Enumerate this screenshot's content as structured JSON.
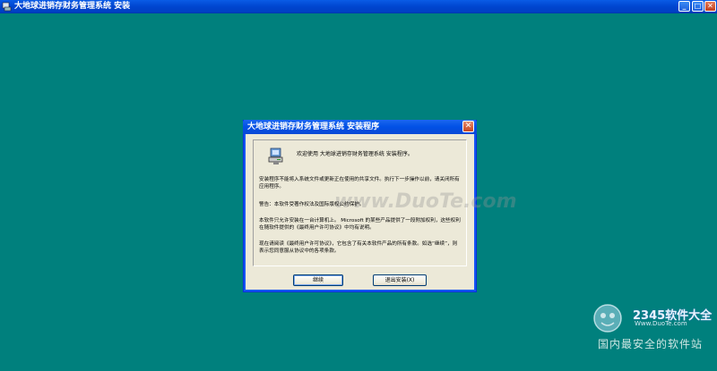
{
  "main_window": {
    "title": "大地球进销存财务管理系统 安装",
    "controls": {
      "minimize": "_",
      "maximize": "□",
      "close": "✕"
    }
  },
  "dialog": {
    "title": "大地球进销存财务管理系统 安装程序",
    "close_glyph": "✕",
    "welcome": "欢迎使用 大地球进销存财务管理系统 安装程序。",
    "paragraph1": "安装程序不能将入系统文件或更新正在使用的共享文件。执行下一步操作以前，请关闭所有应用程序。",
    "paragraph2": "警告：本软件受著作权法及国际版权公约保护。",
    "paragraph3": "本软件只允许安装在一台计算机上。 Microsoft 的某些产品提供了一段附加权利，这些权利在随软件提供的《最终用户许可协议》中均有说明。",
    "paragraph4": "现在请阅读《最终用户许可协议》，它包含了有关本软件产品的所有条款。如选“继续”，则表示您同意服从协议中的各项条款。",
    "buttons": {
      "continue": "继续",
      "exit": "退出安装(X)"
    },
    "watermark": "www.DuoTe.com"
  },
  "site_logo": {
    "brand": "2345软件大全",
    "url": "Www.DuoTe.com",
    "slogan": "国内最安全的软件站"
  },
  "colors": {
    "desktop": "#00807d",
    "titlebar": "#0046d0",
    "dialog_bg": "#ece9d8"
  }
}
